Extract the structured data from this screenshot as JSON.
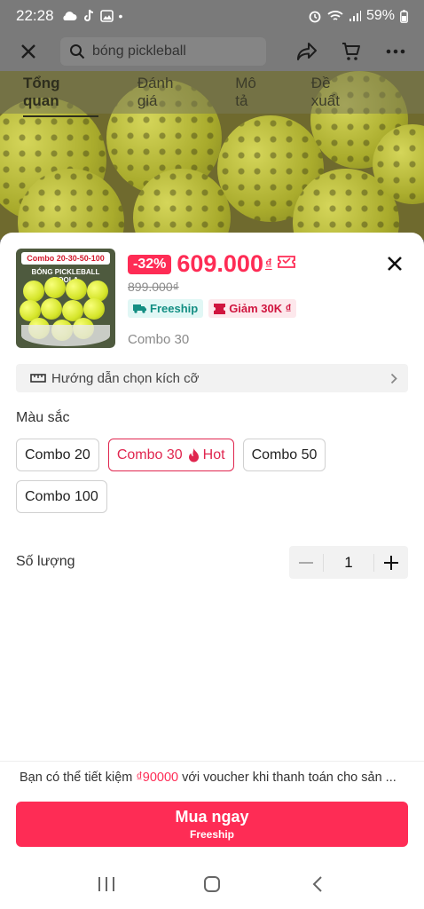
{
  "status_bar": {
    "time": "22:28",
    "battery": "59%"
  },
  "top_bar": {
    "search_placeholder": "bóng pickleball"
  },
  "page_tabs": [
    {
      "label": "Tổng quan",
      "active": true
    },
    {
      "label": "Đánh giá",
      "active": false
    },
    {
      "label": "Mô tả",
      "active": false
    },
    {
      "label": "Đề xuất",
      "active": false
    }
  ],
  "product": {
    "thumb_banner": "Combo 20-30-50-100",
    "thumb_subtitle": "BÓNG PICKLEBALL DOOLA",
    "discount": "-32%",
    "price": "609.000",
    "currency": "₫",
    "original_price": "899.000₫",
    "badges": {
      "shipping": "Freeship",
      "discount": "Giảm 30K ₫"
    },
    "selected_variant": "Combo 30"
  },
  "size_guide": {
    "label": "Hướng dẫn chọn kích cỡ"
  },
  "color_section": {
    "title": "Màu sắc",
    "options": [
      "Combo 20",
      "Combo 30",
      "Combo 50",
      "Combo 100"
    ],
    "hot_label": "Hot",
    "selected": "Combo 30"
  },
  "quantity": {
    "title": "Số lượng",
    "value": "1"
  },
  "voucher": {
    "prefix": "Bạn có thể tiết kiệm",
    "amount": "₫90000",
    "suffix": "với voucher khi thanh toán cho sản ..."
  },
  "buy_button": {
    "label": "Mua ngay",
    "sub_label": "Freeship"
  },
  "colors": {
    "accent": "#fe2c55",
    "selected_border": "#e0264f",
    "freeship_text": "#138e83"
  },
  "icons": [
    "close-icon",
    "search-icon",
    "share-icon",
    "cart-icon",
    "more-icon",
    "ticket-icon",
    "truck-icon",
    "voucher-icon",
    "ruler-icon",
    "chevron-right-icon",
    "fire-icon",
    "minus-icon",
    "plus-icon",
    "recents-icon",
    "home-icon",
    "back-icon"
  ]
}
